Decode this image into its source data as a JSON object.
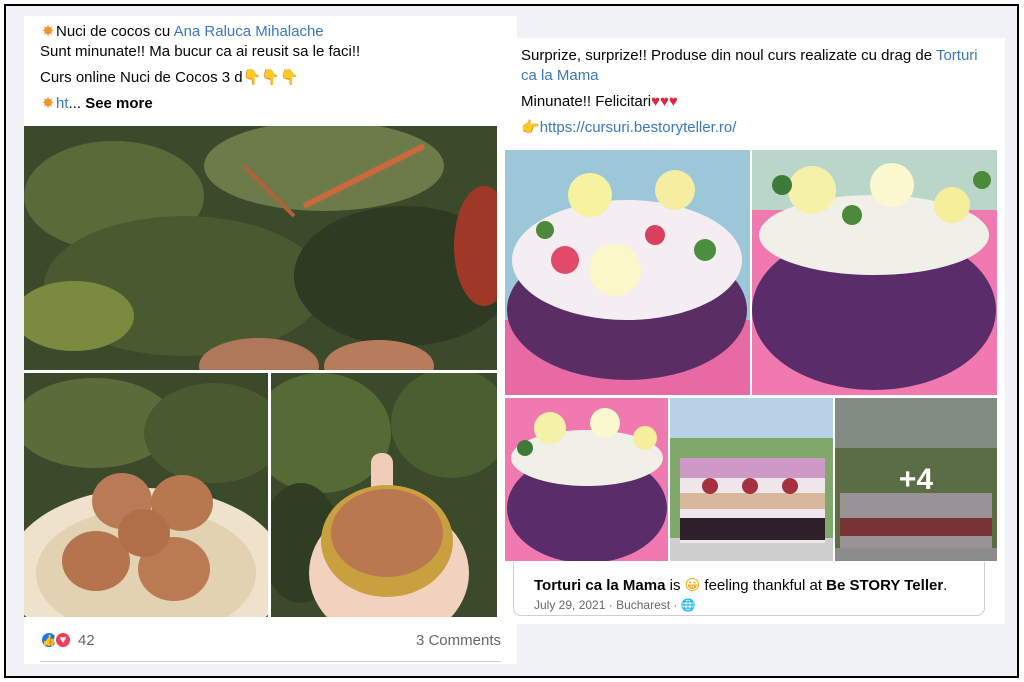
{
  "left_post": {
    "line1_prefix": "Nuci de cocos cu ",
    "line1_link": "Ana Raluca Mihalache",
    "line2": "Sunt minunate!! Ma bucur ca ai reusit sa le faci!!",
    "line3": "Curs online Nuci de Cocos 3 d",
    "line4_link": "ht",
    "line4_ellipsis": "... ",
    "see_more": "See more",
    "reaction_count": "42",
    "comments": "3 Comments"
  },
  "right_post": {
    "line1_prefix": "Surprize, surprize!! Produse din noul curs realizate cu drag de ",
    "line1_link_a": "Torturi",
    "line1_link_b": "ca la Mama",
    "line2": "Minunate!! Felicitari",
    "line3_link": "https://cursuri.bestoryteller.ro/",
    "more_photos": "+4",
    "attach_name": "Torturi ca la Mama",
    "attach_is": " is ",
    "attach_feeling": " feeling thankful at ",
    "attach_place": "Be STORY Teller",
    "attach_period": ".",
    "attach_date": "July 29, 2021",
    "attach_location": "Bucharest"
  },
  "icons": {
    "sparkle": "collision-emoji-icon",
    "point_down": "backhand-index-pointing-down-icon",
    "point_right": "backhand-index-pointing-right-icon",
    "heart": "red-heart-icon",
    "smile": "smiling-face-icon",
    "globe": "globe-icon"
  },
  "colors": {
    "link": "#3b78c3",
    "like": "#1877f2",
    "love": "#f33e58",
    "muted": "#65676b"
  }
}
